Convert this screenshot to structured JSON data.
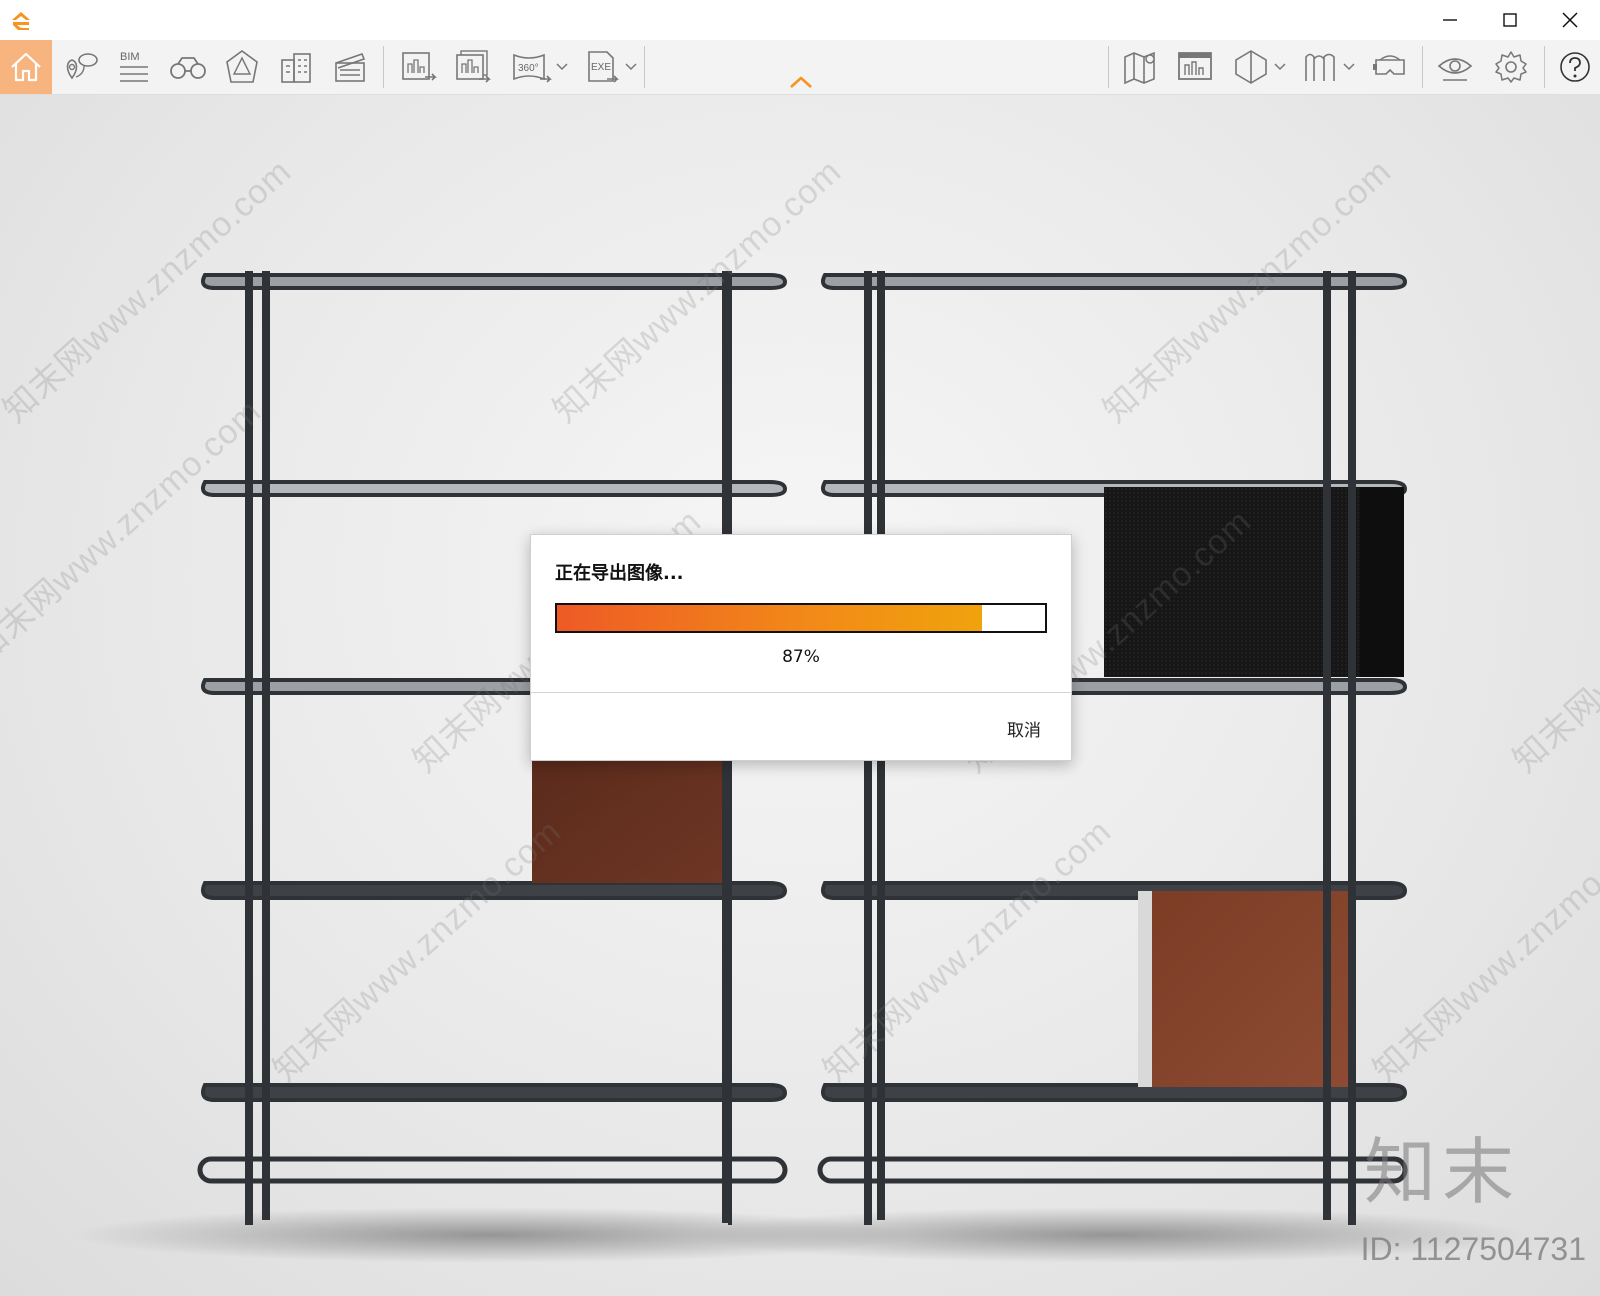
{
  "window": {
    "logo_icon": "e-logo-icon",
    "controls": [
      "minimize-icon",
      "maximize-icon",
      "close-icon"
    ],
    "accent_color": "#f7931e"
  },
  "toolbar": {
    "items": [
      {
        "name": "home-icon",
        "active": true
      },
      {
        "name": "location-pin-icon"
      },
      {
        "name": "bim-icon",
        "label": "BIM"
      },
      {
        "name": "binoculars-icon"
      },
      {
        "name": "camera-view-icon"
      },
      {
        "name": "buildings-icon"
      },
      {
        "name": "clapperboard-icon"
      },
      {
        "name": "export-image-icon"
      },
      {
        "name": "batch-export-icon"
      },
      {
        "name": "export-360-icon",
        "label": "360°",
        "dropdown": true
      },
      {
        "name": "export-exe-icon",
        "label": "EXE",
        "dropdown": true
      },
      {
        "name": "map-icon"
      },
      {
        "name": "image-panel-icon"
      },
      {
        "name": "section-box-icon",
        "dropdown": true
      },
      {
        "name": "library-icon",
        "dropdown": true
      },
      {
        "name": "vr-headset-icon"
      },
      {
        "name": "eye-icon"
      },
      {
        "name": "settings-icon"
      },
      {
        "name": "help-icon"
      }
    ],
    "collapse_icon": "chevron-up-icon"
  },
  "dialog": {
    "title": "正在导出图像...",
    "progress": 0.87,
    "percent_label": "87%",
    "cancel_label": "取消",
    "progress_colors": [
      "#ee5a26",
      "#f0a30c"
    ]
  },
  "watermark": {
    "text": "知末网www.znzmo.com",
    "brand": "知末",
    "id": "ID: 1127504731"
  },
  "scene": {
    "frame_color": "#2f3236",
    "brown_color": "#6a3524",
    "black_panel_color": "#1a1a1a"
  }
}
